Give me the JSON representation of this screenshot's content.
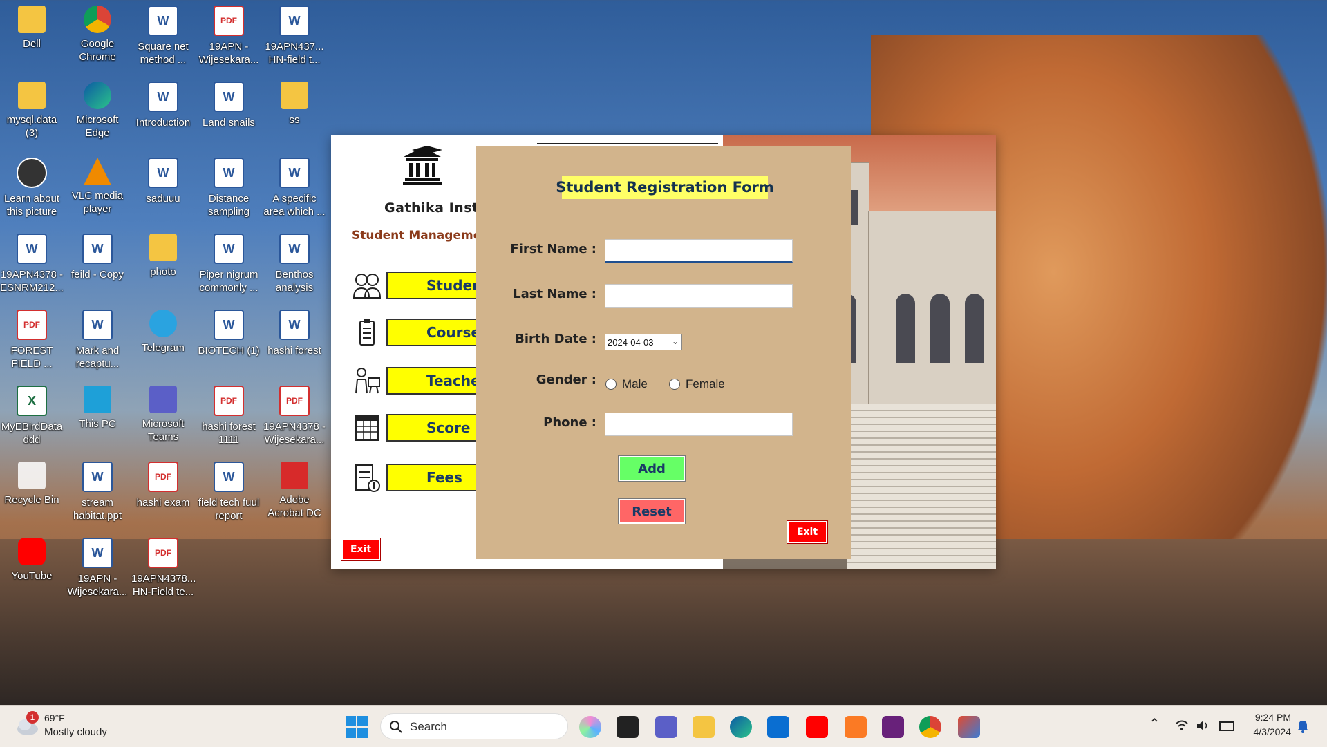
{
  "desktop": {
    "icons": [
      {
        "label": "Dell",
        "icon": "folder-icon"
      },
      {
        "label": "Google Chrome",
        "icon": "chrome-icon"
      },
      {
        "label": "Square net method ...",
        "icon": "word-doc-icon"
      },
      {
        "label": "19APN -Wijesekara...",
        "icon": "pdf-icon"
      },
      {
        "label": "19APN437... HN-field t...",
        "icon": "word-doc-icon"
      },
      {
        "label": "mysql.data (3)",
        "icon": "folder-icon"
      },
      {
        "label": "Microsoft Edge",
        "icon": "edge-icon"
      },
      {
        "label": "Introduction",
        "icon": "word-doc-icon"
      },
      {
        "label": "Land snails",
        "icon": "word-doc-icon"
      },
      {
        "label": "ss",
        "icon": "folder-icon"
      },
      {
        "label": "Learn about this picture",
        "icon": "camera-icon"
      },
      {
        "label": "VLC media player",
        "icon": "vlc-icon"
      },
      {
        "label": "saduuu",
        "icon": "word-doc-icon"
      },
      {
        "label": "Distance sampling",
        "icon": "word-doc-icon"
      },
      {
        "label": "A specific area which ...",
        "icon": "word-doc-icon"
      },
      {
        "label": "19APN4378 -ESNRM212...",
        "icon": "word-doc-icon"
      },
      {
        "label": "feild - Copy",
        "icon": "word-doc-icon"
      },
      {
        "label": "photo",
        "icon": "folder-icon"
      },
      {
        "label": "Piper nigrum commonly ...",
        "icon": "word-doc-icon"
      },
      {
        "label": "Benthos analysis",
        "icon": "word-doc-icon"
      },
      {
        "label": "FOREST FIELD ...",
        "icon": "pdf-icon"
      },
      {
        "label": "Mark and recaptu...",
        "icon": "word-doc-icon"
      },
      {
        "label": "Telegram",
        "icon": "telegram-icon"
      },
      {
        "label": "BIOTECH (1)",
        "icon": "word-doc-icon"
      },
      {
        "label": "hashi forest",
        "icon": "word-doc-icon"
      },
      {
        "label": "MyEBirdData ddd",
        "icon": "excel-icon"
      },
      {
        "label": "This PC",
        "icon": "monitor-icon"
      },
      {
        "label": "Microsoft Teams",
        "icon": "teams-icon"
      },
      {
        "label": "hashi forest 1111",
        "icon": "pdf-icon"
      },
      {
        "label": "19APN4378 -Wijesekara...",
        "icon": "pdf-icon"
      },
      {
        "label": "Recycle Bin",
        "icon": "recycle-bin-icon"
      },
      {
        "label": "stream habitat.ppt",
        "icon": "word-doc-icon"
      },
      {
        "label": "hashi exam",
        "icon": "pdf-icon"
      },
      {
        "label": "field tech fuul report",
        "icon": "word-doc-icon"
      },
      {
        "label": "Adobe Acrobat DC",
        "icon": "acrobat-icon"
      },
      {
        "label": "YouTube",
        "icon": "youtube-icon"
      },
      {
        "label": "19APN -Wijesekara...",
        "icon": "word-doc-icon"
      },
      {
        "label": "19APN4378... HN-Field te...",
        "icon": "pdf-icon"
      }
    ],
    "word_glyph": "W",
    "pdf_glyph": "PDF",
    "excel_glyph": "X"
  },
  "app": {
    "institute_name": "Gathika Institut",
    "subtitle": "Student Management",
    "menu": [
      {
        "label": "Student",
        "icon": "students-icon"
      },
      {
        "label": "Course",
        "icon": "clipboard-icon"
      },
      {
        "label": "Teacher",
        "icon": "teacher-icon"
      },
      {
        "label": "Score",
        "icon": "score-icon"
      },
      {
        "label": "Fees",
        "icon": "fee-icon"
      }
    ],
    "exit_label": "Exit"
  },
  "form": {
    "title": "Student Registration Form",
    "first_name_label": "First Name :",
    "last_name_label": "Last Name :",
    "birth_date_label": "Birth Date :",
    "birth_date_value": "2024-04-03",
    "gender_label": "Gender :",
    "gender_male": "Male",
    "gender_female": "Female",
    "phone_label": "Phone :",
    "first_name_value": "",
    "last_name_value": "",
    "phone_value": "",
    "add_label": "Add",
    "reset_label": "Reset",
    "exit_label": "Exit",
    "colors": {
      "background": "#d2b48c",
      "title_bg": "#ffff66",
      "add_bg": "#66ff66",
      "reset_bg": "#ff6666",
      "exit_bg": "#ff0000"
    }
  },
  "taskbar": {
    "weather_temp": "69°F",
    "weather_desc": "Mostly cloudy",
    "weather_badge": "1",
    "search_placeholder": "Search",
    "time": "9:24 PM",
    "date": "4/3/2024"
  }
}
